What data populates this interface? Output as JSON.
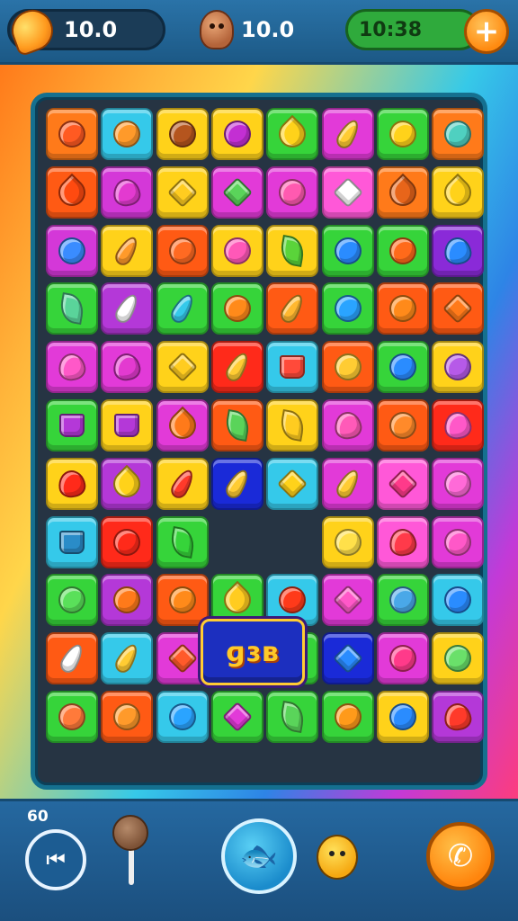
{
  "hud": {
    "left_value": "10.0",
    "middle_value": "10.0",
    "timer": "10:38",
    "plus_symbol": "+"
  },
  "board": {
    "special_tile_text": "ɡɜʙ",
    "special_tile_color": "#1c2fbf",
    "rows": [
      [
        {
          "c": "#ff7a1a",
          "g": "ball",
          "gc": "#ff5a22"
        },
        {
          "c": "#35c9ea",
          "g": "ball",
          "gc": "#ff9a2a"
        },
        {
          "c": "#ffd21a",
          "g": "ball",
          "gc": "#b5551e"
        },
        {
          "c": "#ffd21a",
          "g": "ball",
          "gc": "#c32fd3"
        },
        {
          "c": "#36d43a",
          "g": "drop",
          "gc": "#ffd21a"
        },
        {
          "c": "#e23ad8",
          "g": "carrot",
          "gc": "#ffcc33"
        },
        {
          "c": "#36d43a",
          "g": "ball",
          "gc": "#ffd21a"
        },
        {
          "c": "#ff7a1a",
          "g": "ball",
          "gc": "#4fd0c0"
        }
      ],
      [
        {
          "c": "#ff5a14",
          "g": "drop",
          "gc": "#ff4a10"
        },
        {
          "c": "#d438d8",
          "g": "heart",
          "gc": "#e33ad0"
        },
        {
          "c": "#ffd21a",
          "g": "star",
          "gc": "#ffcc20"
        },
        {
          "c": "#e23ad8",
          "g": "star",
          "gc": "#5ad45a"
        },
        {
          "c": "#e23ad8",
          "g": "ball",
          "gc": "#ff5ab0"
        },
        {
          "c": "#ff58d8",
          "g": "star",
          "gc": "#ffffff"
        },
        {
          "c": "#ff7a1a",
          "g": "drop",
          "gc": "#e8651a"
        },
        {
          "c": "#ffd21a",
          "g": "drop",
          "gc": "#ffd21a"
        }
      ],
      [
        {
          "c": "#d438d8",
          "g": "ball",
          "gc": "#3a8cff"
        },
        {
          "c": "#ffd21a",
          "g": "carrot",
          "gc": "#ff9a2a"
        },
        {
          "c": "#ff5a14",
          "g": "ball",
          "gc": "#ff6a22"
        },
        {
          "c": "#ffd21a",
          "g": "ball",
          "gc": "#ff58b8"
        },
        {
          "c": "#ffd21a",
          "g": "leaf",
          "gc": "#5ad43a"
        },
        {
          "c": "#36d43a",
          "g": "ball",
          "gc": "#2a8cff"
        },
        {
          "c": "#36d43a",
          "g": "ball",
          "gc": "#ff6a1a"
        },
        {
          "c": "#8a2ad8",
          "g": "heart",
          "gc": "#2a8cff"
        }
      ],
      [
        {
          "c": "#36d43a",
          "g": "leaf",
          "gc": "#5ad49a"
        },
        {
          "c": "#b438d8",
          "g": "carrot",
          "gc": "#ffffff"
        },
        {
          "c": "#36d43a",
          "g": "carrot",
          "gc": "#35c9ea"
        },
        {
          "c": "#36d43a",
          "g": "ball",
          "gc": "#ff8a1a"
        },
        {
          "c": "#ff5a14",
          "g": "carrot",
          "gc": "#ffb830"
        },
        {
          "c": "#36d43a",
          "g": "ball",
          "gc": "#2aa4ff"
        },
        {
          "c": "#ff5a14",
          "g": "ball",
          "gc": "#ff8a1a"
        },
        {
          "c": "#ff5a14",
          "g": "star",
          "gc": "#ff7a1a"
        }
      ],
      [
        {
          "c": "#e23ad8",
          "g": "heart",
          "gc": "#ff58c8"
        },
        {
          "c": "#e23ad8",
          "g": "heart",
          "gc": "#e33ad0"
        },
        {
          "c": "#ffd21a",
          "g": "star",
          "gc": "#ffcc20"
        },
        {
          "c": "#ff2a1a",
          "g": "carrot",
          "gc": "#ffcc33"
        },
        {
          "c": "#35c9ea",
          "g": "cup",
          "gc": "#ff4a3a"
        },
        {
          "c": "#ff5a14",
          "g": "ball",
          "gc": "#ffcc33"
        },
        {
          "c": "#36d43a",
          "g": "ball",
          "gc": "#2a8cff"
        },
        {
          "c": "#ffd21a",
          "g": "ball",
          "gc": "#b65ae8"
        }
      ],
      [
        {
          "c": "#36d43a",
          "g": "cup",
          "gc": "#b438d8"
        },
        {
          "c": "#ffd21a",
          "g": "cup",
          "gc": "#b438d8"
        },
        {
          "c": "#e23ad8",
          "g": "drop",
          "gc": "#ff7a1a"
        },
        {
          "c": "#ff5a14",
          "g": "leaf",
          "gc": "#5ad45a"
        },
        {
          "c": "#ffd21a",
          "g": "leaf",
          "gc": "#ffcc20"
        },
        {
          "c": "#e23ad8",
          "g": "heart",
          "gc": "#ff5ab8"
        },
        {
          "c": "#ff5a14",
          "g": "ball",
          "gc": "#ff8a2a"
        },
        {
          "c": "#ff2a1a",
          "g": "heart",
          "gc": "#ff58c8"
        }
      ],
      [
        {
          "c": "#ffd21a",
          "g": "heart",
          "gc": "#ff2a1a"
        },
        {
          "c": "#b438d8",
          "g": "drop",
          "gc": "#ffd21a"
        },
        {
          "c": "#ffd21a",
          "g": "carrot",
          "gc": "#ff3a2a"
        },
        {
          "c": "#1a2ad8",
          "g": "carrot",
          "gc": "#ffcc33"
        },
        {
          "c": "#35c9ea",
          "g": "star",
          "gc": "#ffd21a"
        },
        {
          "c": "#e23ad8",
          "g": "carrot",
          "gc": "#ffcc33"
        },
        {
          "c": "#ff58d8",
          "g": "star",
          "gc": "#ff3a8a"
        },
        {
          "c": "#e23ad8",
          "g": "ball",
          "gc": "#ff6ad8"
        }
      ],
      [
        {
          "c": "#35c9ea",
          "g": "cup",
          "gc": "#2a8cc8"
        },
        {
          "c": "#ff2a1a",
          "g": "ball",
          "gc": "#ff2a1a"
        },
        {
          "c": "#36d43a",
          "g": "leaf",
          "gc": "#36d43a"
        },
        null,
        null,
        {
          "c": "#ffd21a",
          "g": "ball",
          "gc": "#ffe04a"
        },
        {
          "c": "#ff58d8",
          "g": "heart",
          "gc": "#ff3a4a"
        },
        {
          "c": "#e23ad8",
          "g": "ball",
          "gc": "#ff58c8"
        }
      ],
      [
        {
          "c": "#36d43a",
          "g": "ball",
          "gc": "#5ae05a"
        },
        {
          "c": "#b438d8",
          "g": "ball",
          "gc": "#ff7a1a"
        },
        {
          "c": "#ff5a14",
          "g": "ball",
          "gc": "#ff8a1a"
        },
        {
          "c": "#36d43a",
          "g": "drop",
          "gc": "#ffcc20"
        },
        {
          "c": "#35c9ea",
          "g": "ball",
          "gc": "#ff3a1a"
        },
        {
          "c": "#e23ad8",
          "g": "star",
          "gc": "#ff58c8"
        },
        {
          "c": "#36d43a",
          "g": "ball",
          "gc": "#4aa8e8"
        },
        {
          "c": "#35c9ea",
          "g": "ball",
          "gc": "#2a8cff"
        }
      ],
      [
        {
          "c": "#ff5a14",
          "g": "carrot",
          "gc": "#ffffff"
        },
        {
          "c": "#35c9ea",
          "g": "carrot",
          "gc": "#ffcc33"
        },
        {
          "c": "#e23ad8",
          "g": "star",
          "gc": "#ff5a2a"
        },
        {
          "c": "#e23ad8",
          "g": "ball",
          "gc": "#ff6ad8"
        },
        {
          "c": "#36d43a",
          "g": "ball",
          "gc": "#5ae05a"
        },
        {
          "c": "#1a2ad8",
          "g": "star",
          "gc": "#2a8cff"
        },
        {
          "c": "#e23ad8",
          "g": "ball",
          "gc": "#ff3a8a"
        },
        {
          "c": "#ffd21a",
          "g": "ball",
          "gc": "#6ae06a"
        }
      ],
      [
        {
          "c": "#36d43a",
          "g": "ball",
          "gc": "#ff7a3a"
        },
        {
          "c": "#ff5a14",
          "g": "ball",
          "gc": "#ff9a2a"
        },
        {
          "c": "#35c9ea",
          "g": "ball",
          "gc": "#2aa4ff"
        },
        {
          "c": "#36d43a",
          "g": "star",
          "gc": "#e23ad8"
        },
        {
          "c": "#36d43a",
          "g": "leaf",
          "gc": "#5ad45a"
        },
        {
          "c": "#36d43a",
          "g": "ball",
          "gc": "#ff9a1a"
        },
        {
          "c": "#ffd21a",
          "g": "ball",
          "gc": "#2a8cff"
        },
        {
          "c": "#b438d8",
          "g": "heart",
          "gc": "#ff3a2a"
        }
      ]
    ]
  },
  "bottom": {
    "counter": "60",
    "rewind_icon": "⏮",
    "fish_icon": "🐟",
    "phone_icon": "✆"
  }
}
